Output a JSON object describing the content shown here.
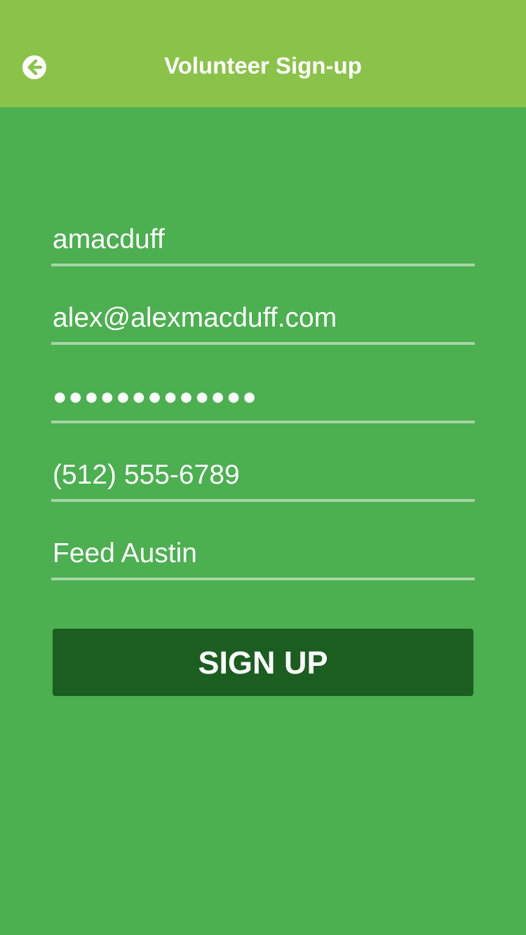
{
  "header": {
    "title": "Volunteer Sign-up",
    "back_icon": "arrow-left-circle-icon"
  },
  "form": {
    "username": "amacduff",
    "email": "alex@alexmacduff.com",
    "password_masked": "●●●●●●●●●●●●●",
    "phone": "(512) 555-6789",
    "organization": "Feed Austin"
  },
  "actions": {
    "signup_label": "SIGN UP"
  },
  "colors": {
    "header_bg": "#8bc34a",
    "page_bg": "#4caf50",
    "button_bg": "#1b5e20",
    "underline": "#a5d6a7"
  }
}
